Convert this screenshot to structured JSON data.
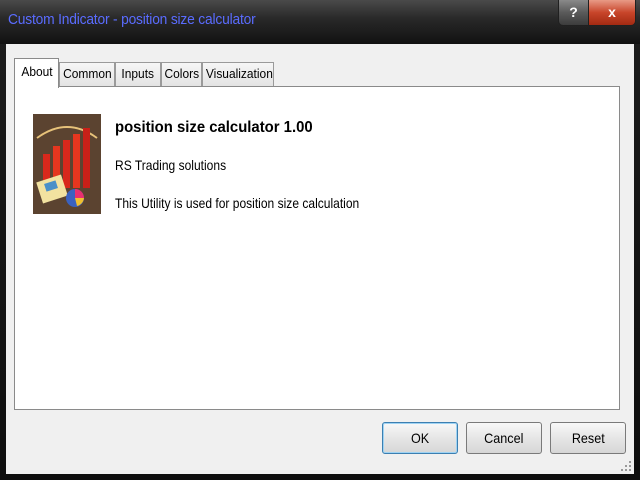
{
  "window": {
    "title": "Custom Indicator - position size calculator"
  },
  "caption_buttons": {
    "help": "?",
    "close": "x"
  },
  "tabs": [
    {
      "label": "About",
      "active": true
    },
    {
      "label": "Common",
      "active": false
    },
    {
      "label": "Inputs",
      "active": false
    },
    {
      "label": "Colors",
      "active": false
    },
    {
      "label": "Visualization",
      "active": false
    }
  ],
  "about": {
    "name": "position size calculator 1.00",
    "author": "RS Trading solutions",
    "description": "This Utility is used for position size calculation",
    "logo_icon": "bar-chart-icon"
  },
  "buttons": {
    "ok": "OK",
    "cancel": "Cancel",
    "reset": "Reset"
  },
  "colors": {
    "title_text": "#5a6cff",
    "close_button": "#c8452a",
    "dialog_bg": "#f0f0f0"
  }
}
